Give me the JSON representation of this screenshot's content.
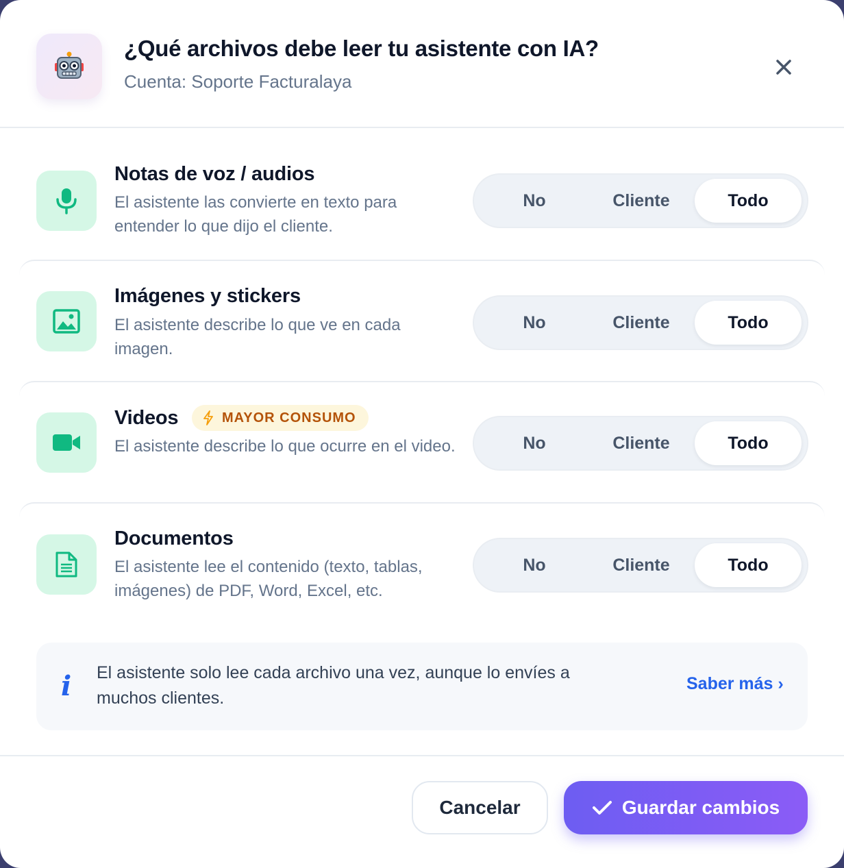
{
  "header": {
    "title": "¿Qué archivos debe leer tu asistente con IA?",
    "subtitle": "Cuenta: Soporte Facturalaya",
    "icon": "robot-icon",
    "close_icon": "close-icon"
  },
  "options": [
    "No",
    "Cliente",
    "Todo"
  ],
  "rows": [
    {
      "title": "Notas de voz / audios",
      "description": "El asistente las convierte en texto para entender lo que dijo el cliente.",
      "icon": "microphone-icon",
      "selected": "Todo"
    },
    {
      "title": "Imágenes y stickers",
      "description": "El asistente describe lo que ve en cada imagen.",
      "icon": "image-icon",
      "selected": "Todo"
    },
    {
      "title": "Videos",
      "badge": "MAYOR CONSUMO",
      "description": "El asistente describe lo que ocurre en el video.",
      "icon": "video-camera-icon",
      "selected": "Todo"
    },
    {
      "title": "Documentos",
      "description": "El asistente lee el contenido (texto, tablas, imágenes) de PDF, Word, Excel, etc.",
      "icon": "document-icon",
      "selected": "Todo"
    }
  ],
  "info": {
    "text": "El asistente solo lee cada archivo una vez, aunque lo envíes a muchos clientes.",
    "link": "Saber más ›",
    "icon": "info-icon"
  },
  "footer": {
    "cancel": "Cancelar",
    "save": "Guardar cambios"
  },
  "colors": {
    "accent": "#6d5df2",
    "icon_green": "#10b981",
    "link_blue": "#2563eb",
    "badge_orange": "#b45309"
  }
}
